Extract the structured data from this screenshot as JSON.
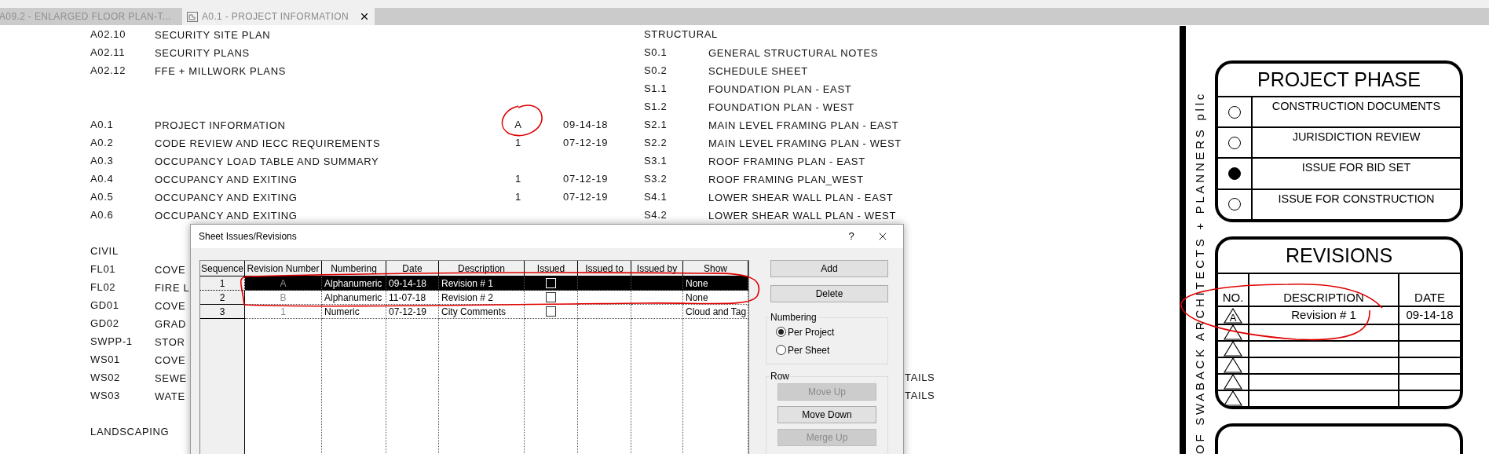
{
  "tabs": [
    {
      "label": "A09.2 - ENLARGED FLOOR PLAN-T...",
      "selected": false
    },
    {
      "label": "A0.1 - PROJECT INFORMATION",
      "selected": true
    }
  ],
  "sheet_list": {
    "left": [
      {
        "kind": "sheet",
        "number": "A02.10",
        "title": "SECURITY SITE PLAN"
      },
      {
        "kind": "sheet",
        "number": "A02.11",
        "title": "SECURITY PLANS"
      },
      {
        "kind": "sheet",
        "number": "A02.12",
        "title": "FFE + MILLWORK PLANS"
      },
      {
        "kind": "gap"
      },
      {
        "kind": "gap"
      },
      {
        "kind": "sheet",
        "number": "A0.1",
        "title": "PROJECT INFORMATION",
        "revision": "A",
        "date": "09-14-18"
      },
      {
        "kind": "sheet",
        "number": "A0.2",
        "title": "CODE REVIEW AND IECC REQUIREMENTS",
        "revision": "1",
        "date": "07-12-19"
      },
      {
        "kind": "sheet",
        "number": "A0.3",
        "title": "OCCUPANCY LOAD TABLE AND SUMMARY"
      },
      {
        "kind": "sheet",
        "number": "A0.4",
        "title": "OCCUPANCY AND EXITING",
        "revision": "1",
        "date": "07-12-19"
      },
      {
        "kind": "sheet",
        "number": "A0.5",
        "title": "OCCUPANCY AND EXITING",
        "revision": "1",
        "date": "07-12-19"
      },
      {
        "kind": "sheet",
        "number": "A0.6",
        "title": "OCCUPANCY AND EXITING"
      },
      {
        "kind": "gap"
      },
      {
        "kind": "heading",
        "title": "CIVIL"
      },
      {
        "kind": "sheet",
        "number": "FL01",
        "title": "COVE"
      },
      {
        "kind": "sheet",
        "number": "FL02",
        "title": "FIRE L"
      },
      {
        "kind": "sheet",
        "number": "GD01",
        "title": "COVE"
      },
      {
        "kind": "sheet",
        "number": "GD02",
        "title": "GRAD"
      },
      {
        "kind": "sheet",
        "number": "SWPP-1",
        "title": "STOR"
      },
      {
        "kind": "sheet",
        "number": "WS01",
        "title": "COVE"
      },
      {
        "kind": "sheet",
        "number": "WS02",
        "title": "SEWE"
      },
      {
        "kind": "sheet",
        "number": "WS03",
        "title": "WATE"
      },
      {
        "kind": "gap"
      },
      {
        "kind": "heading",
        "title": "LANDSCAPING"
      }
    ],
    "right": [
      {
        "kind": "heading",
        "title": "STRUCTURAL"
      },
      {
        "kind": "sheet",
        "number": "S0.1",
        "title": "GENERAL STRUCTURAL NOTES"
      },
      {
        "kind": "sheet",
        "number": "S0.2",
        "title": "SCHEDULE SHEET"
      },
      {
        "kind": "sheet",
        "number": "S1.1",
        "title": "FOUNDATION PLAN - EAST"
      },
      {
        "kind": "sheet",
        "number": "S1.2",
        "title": "FOUNDATION PLAN - WEST"
      },
      {
        "kind": "sheet",
        "number": "S2.1",
        "title": "MAIN LEVEL FRAMING PLAN - EAST"
      },
      {
        "kind": "sheet",
        "number": "S2.2",
        "title": "MAIN LEVEL FRAMING PLAN - WEST"
      },
      {
        "kind": "sheet",
        "number": "S3.1",
        "title": "ROOF FRAMING PLAN - EAST"
      },
      {
        "kind": "sheet",
        "number": "S3.2",
        "title": "ROOF FRAMING PLAN_WEST"
      },
      {
        "kind": "sheet",
        "number": "S4.1",
        "title": "LOWER SHEAR WALL PLAN - EAST"
      },
      {
        "kind": "sheet",
        "number": "S4.2",
        "title": "LOWER SHEAR WALL PLAN - WEST"
      },
      {
        "kind": "gap"
      },
      {
        "kind": "gap"
      },
      {
        "kind": "gap"
      },
      {
        "kind": "gap"
      },
      {
        "kind": "gap"
      },
      {
        "kind": "gap"
      },
      {
        "kind": "gap"
      },
      {
        "kind": "gap"
      },
      {
        "kind": "fragment",
        "title": "TAILS"
      },
      {
        "kind": "fragment",
        "title": "TAILS"
      }
    ]
  },
  "dialog": {
    "title": "Sheet Issues/Revisions",
    "help": "?",
    "columns": [
      "Sequence",
      "Revision Number",
      "Numbering",
      "Date",
      "Description",
      "Issued",
      "Issued to",
      "Issued by",
      "Show"
    ],
    "rows": [
      {
        "sequence": "1",
        "revision_number": "A",
        "numbering": "Alphanumeric",
        "date": "09-14-18",
        "description": "Revision # 1",
        "issued": false,
        "show": "None",
        "selected": true
      },
      {
        "sequence": "2",
        "revision_number": "B",
        "numbering": "Alphanumeric",
        "date": "11-07-18",
        "description": "Revision # 2",
        "issued": false,
        "show": "None",
        "selected": false
      },
      {
        "sequence": "3",
        "revision_number": "1",
        "numbering": "Numeric",
        "date": "07-12-19",
        "description": "City Comments",
        "issued": false,
        "show": "Cloud and Tag",
        "selected": false
      }
    ],
    "buttons": [
      {
        "label": "Add",
        "disabled": false
      },
      {
        "label": "Delete",
        "disabled": false
      }
    ],
    "numbering_group": {
      "label": "Numbering",
      "options": [
        {
          "label": "Per Project",
          "selected": true
        },
        {
          "label": "Per Sheet",
          "selected": false
        }
      ]
    },
    "row_group": {
      "label": "Row",
      "buttons": [
        {
          "label": "Move Up",
          "disabled": true
        },
        {
          "label": "Move Down",
          "disabled": false
        },
        {
          "label": "Merge Up",
          "disabled": true
        }
      ]
    }
  },
  "title_block": {
    "firm_text": "OF SWABACK ARCHITECTS + PLANNERS pllc",
    "phase": {
      "title": "PROJECT PHASE",
      "options": [
        {
          "label": "CONSTRUCTION DOCUMENTS",
          "selected": false
        },
        {
          "label": "JURISDICTION REVIEW",
          "selected": false
        },
        {
          "label": "ISSUE FOR BID SET",
          "selected": true
        },
        {
          "label": "ISSUE FOR CONSTRUCTION",
          "selected": false
        }
      ]
    },
    "revisions": {
      "title": "REVISIONS",
      "columns": [
        "NO.",
        "DESCRIPTION",
        "DATE"
      ],
      "rows": [
        {
          "no": "A",
          "description": "Revision # 1",
          "date": "09-14-18"
        },
        {},
        {},
        {},
        {},
        {}
      ]
    }
  }
}
